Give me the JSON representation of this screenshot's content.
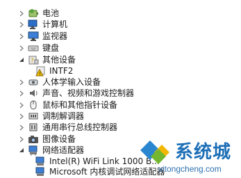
{
  "tree": {
    "items": [
      {
        "label": "电池",
        "icon": "battery-icon",
        "expanded": false
      },
      {
        "label": "计算机",
        "icon": "computer-icon",
        "expanded": false
      },
      {
        "label": "监视器",
        "icon": "monitor-icon",
        "expanded": false
      },
      {
        "label": "键盘",
        "icon": "keyboard-icon",
        "expanded": false
      },
      {
        "label": "其他设备",
        "icon": "other-devices-icon",
        "expanded": true
      },
      {
        "label": "INTF2",
        "icon": "unknown-device-warning-icon"
      },
      {
        "label": "人体学输入设备",
        "icon": "hid-icon",
        "expanded": false
      },
      {
        "label": "声音、视频和游戏控制器",
        "icon": "speaker-icon",
        "expanded": false
      },
      {
        "label": "鼠标和其他指针设备",
        "icon": "mouse-icon",
        "expanded": false
      },
      {
        "label": "调制解调器",
        "icon": "modem-icon",
        "expanded": false
      },
      {
        "label": "通用串行总线控制器",
        "icon": "usb-controller-icon",
        "expanded": false
      },
      {
        "label": "图像设备",
        "icon": "camera-icon",
        "expanded": false
      },
      {
        "label": "网络适配器",
        "icon": "network-adapter-icon",
        "expanded": true
      },
      {
        "label": "Intel(R) WiFi Link 1000 B...",
        "icon": "network-card-icon"
      },
      {
        "label": "Microsoft 内核调试网络适配器",
        "icon": "network-card-icon"
      }
    ]
  },
  "watermark": {
    "title": "系统城",
    "url": "xitongcheng.com"
  }
}
